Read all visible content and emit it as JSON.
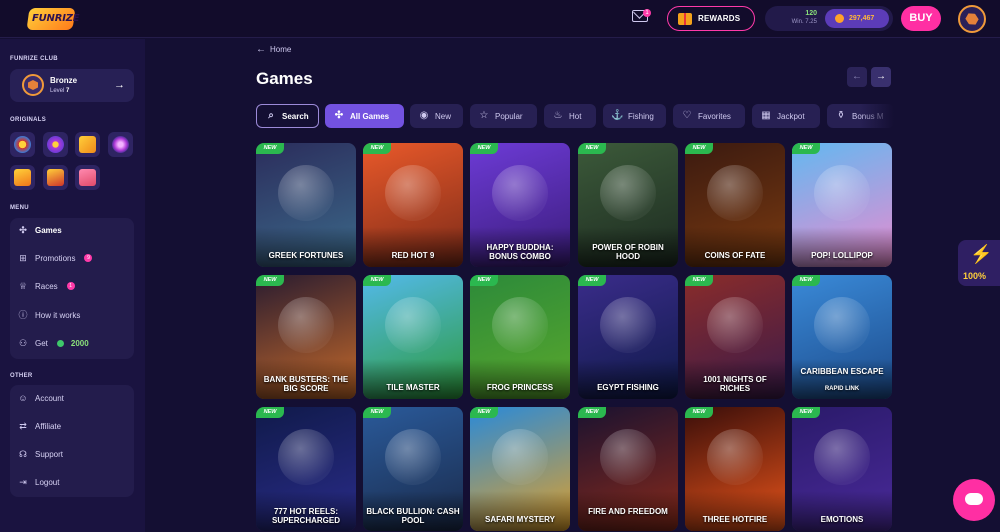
{
  "header": {
    "logo_text": "FUNRIZE",
    "mail_count": "1",
    "rewards_count": "5",
    "rewards_label": "REWARDS",
    "green_balance": "120",
    "green_sub": "Win. 7.25",
    "orange_balance": "297,467",
    "buy_label": "BUY"
  },
  "sidebar": {
    "club_label": "FUNRIZE CLUB",
    "club_name": "Bronze",
    "club_level_prefix": "Level",
    "club_level_value": "7",
    "originals_label": "ORIGINALS",
    "menu_label": "MENU",
    "menu": [
      {
        "label": "Games",
        "icon": "games-icon"
      },
      {
        "label": "Promotions",
        "icon": "gift-icon",
        "badge": "9"
      },
      {
        "label": "Races",
        "icon": "trophy-icon",
        "badge": "1"
      },
      {
        "label": "How it works",
        "icon": "info-icon"
      },
      {
        "label": "Get",
        "icon": "referral-icon",
        "value": "2000"
      }
    ],
    "other_label": "OTHER",
    "other": [
      {
        "label": "Account",
        "icon": "user-icon"
      },
      {
        "label": "Affiliate",
        "icon": "handshake-icon"
      },
      {
        "label": "Support",
        "icon": "headset-icon"
      },
      {
        "label": "Logout",
        "icon": "logout-icon"
      }
    ]
  },
  "main": {
    "breadcrumb": "Home",
    "title": "Games",
    "categories": [
      {
        "label": "Search",
        "icon": "search-icon"
      },
      {
        "label": "All Games",
        "icon": "all-games-icon"
      },
      {
        "label": "New",
        "icon": "new-icon"
      },
      {
        "label": "Popular",
        "icon": "star-icon"
      },
      {
        "label": "Hot",
        "icon": "flame-icon"
      },
      {
        "label": "Fishing",
        "icon": "fishing-icon"
      },
      {
        "label": "Favorites",
        "icon": "heart-icon"
      },
      {
        "label": "Jackpot",
        "icon": "jackpot-icon"
      },
      {
        "label": "Bonus M",
        "icon": "bonus-icon"
      }
    ],
    "new_badge": "NEW",
    "games": [
      {
        "name": "GREEK FORTUNES",
        "sub": "",
        "colors": [
          "#2b2d5c",
          "#3c6a8a"
        ]
      },
      {
        "name": "RED HOT 9",
        "sub": "",
        "colors": [
          "#e9592a",
          "#7b2a18"
        ]
      },
      {
        "name": "HAPPY BUDDHA: BONUS COMBO",
        "sub": "",
        "colors": [
          "#6d3bd6",
          "#3a1c7a"
        ]
      },
      {
        "name": "POWER OF ROBIN HOOD",
        "sub": "",
        "colors": [
          "#3c5a3a",
          "#1c2a20"
        ]
      },
      {
        "name": "COINS OF FATE",
        "sub": "",
        "colors": [
          "#3b1a10",
          "#7a3a10"
        ]
      },
      {
        "name": "POP! LOLLIPOP",
        "sub": "",
        "colors": [
          "#63b8f0",
          "#e98bd0"
        ]
      },
      {
        "name": "BANK BUSTERS: THE BIG SCORE",
        "sub": "",
        "colors": [
          "#2a1c30",
          "#c66a2a"
        ]
      },
      {
        "name": "TILE MASTER",
        "sub": "",
        "colors": [
          "#53b9ea",
          "#2c9a3a"
        ]
      },
      {
        "name": "FROG PRINCESS",
        "sub": "",
        "colors": [
          "#2c8a3a",
          "#5aa82c"
        ]
      },
      {
        "name": "EGYPT FISHING",
        "sub": "",
        "colors": [
          "#3a2c8a",
          "#0f1a4a"
        ]
      },
      {
        "name": "1001 NIGHTS OF RICHES",
        "sub": "",
        "colors": [
          "#8a2c2a",
          "#3a1a4a"
        ]
      },
      {
        "name": "CARIBBEAN ESCAPE",
        "sub": "RAPID LINK",
        "colors": [
          "#3a8ad8",
          "#1c4a8a"
        ]
      },
      {
        "name": "777 HOT REELS: SUPERCHARGED",
        "sub": "",
        "colors": [
          "#101a4a",
          "#2a2c8a"
        ]
      },
      {
        "name": "BLACK BULLION: CASH POOL",
        "sub": "",
        "colors": [
          "#2a5a9a",
          "#1a2a4a"
        ]
      },
      {
        "name": "SAFARI MYSTERY",
        "sub": "",
        "colors": [
          "#2a8ad8",
          "#e0a02a"
        ]
      },
      {
        "name": "FIRE AND FREEDOM",
        "sub": "",
        "colors": [
          "#1a1230",
          "#8a2a1a"
        ]
      },
      {
        "name": "THREE HOTFIRE",
        "sub": "",
        "colors": [
          "#3a0e0a",
          "#e9541a"
        ]
      },
      {
        "name": "EMOTIONS",
        "sub": "",
        "colors": [
          "#2a1a6a",
          "#4a2a9a"
        ]
      }
    ]
  },
  "boost": {
    "value": "100%"
  }
}
